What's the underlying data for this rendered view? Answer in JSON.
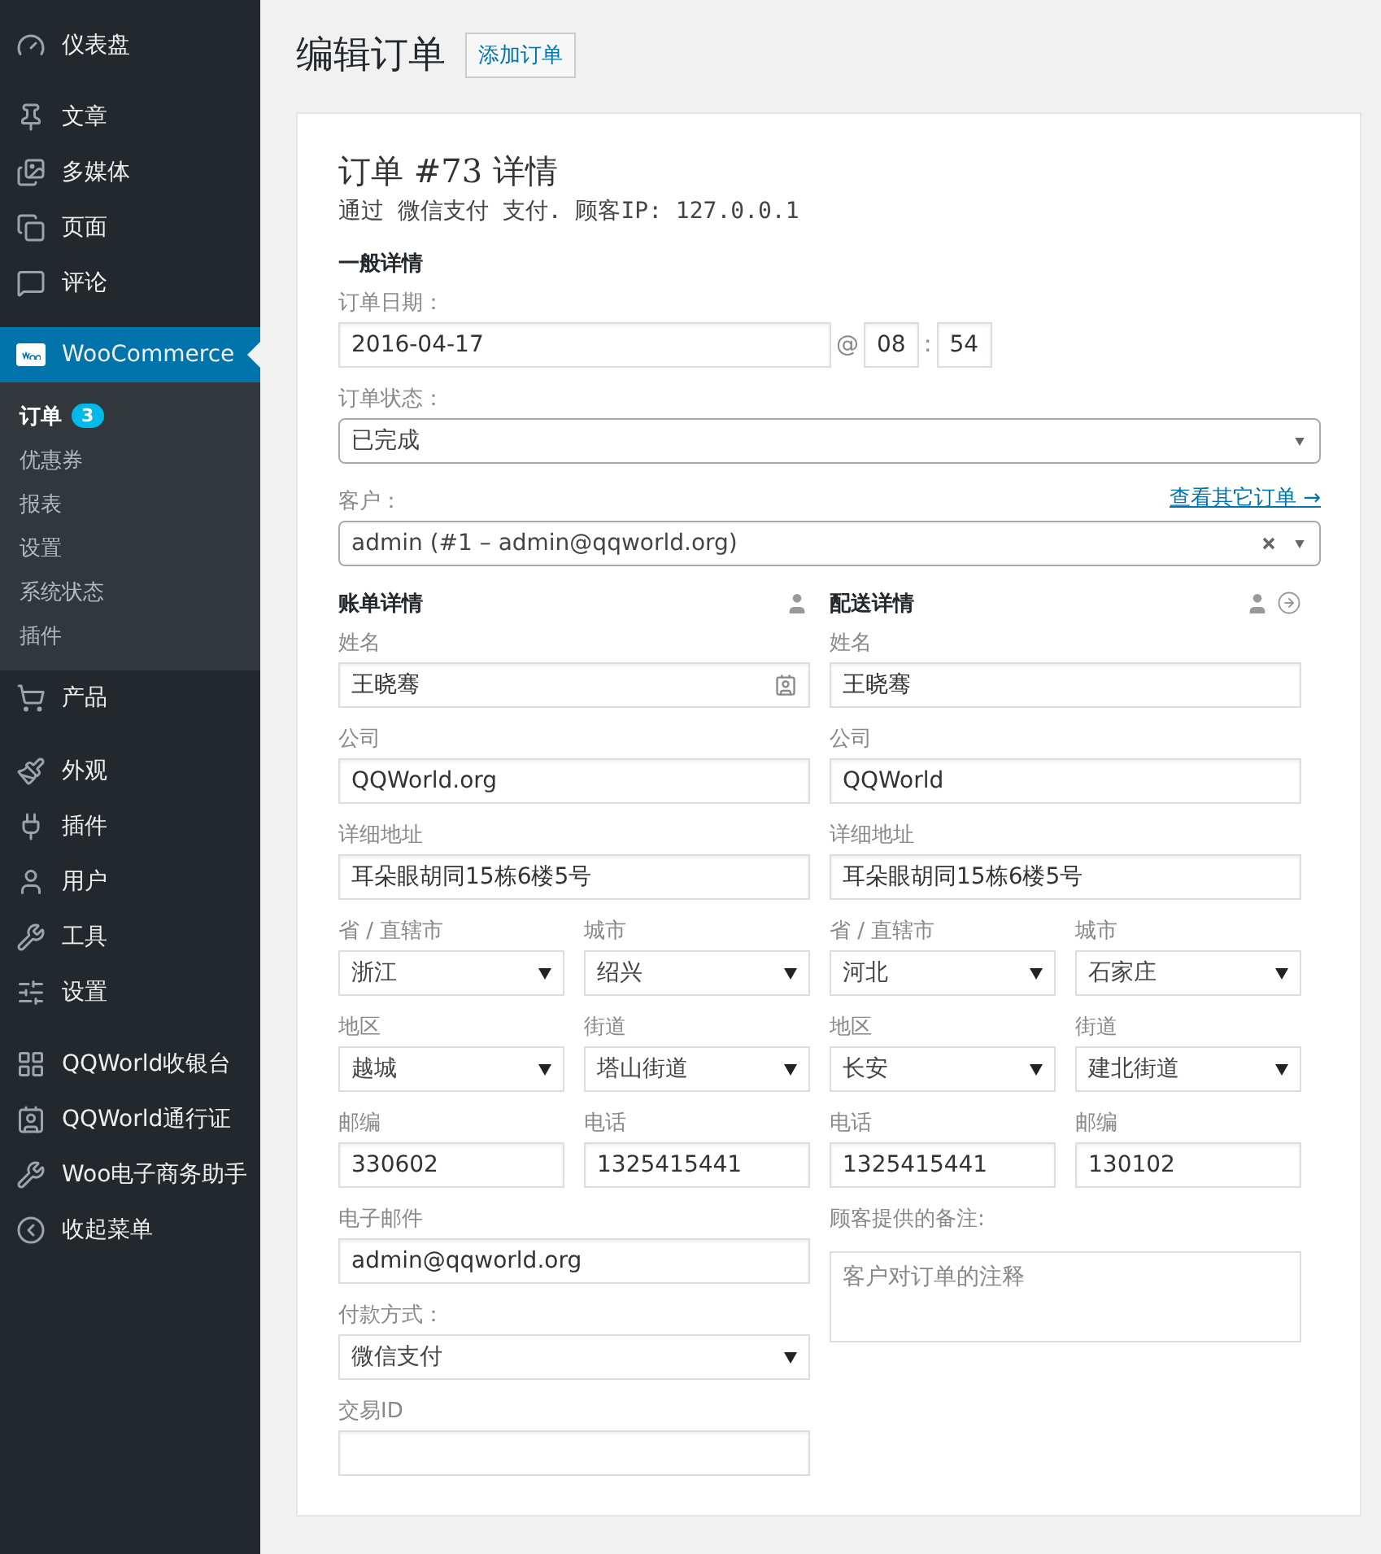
{
  "sidebar": {
    "groups": [
      [
        {
          "label": "仪表盘",
          "selected": false
        }
      ],
      [
        {
          "label": "文章",
          "selected": false
        },
        {
          "label": "多媒体",
          "selected": false
        },
        {
          "label": "页面",
          "selected": false
        },
        {
          "label": "评论",
          "selected": false
        }
      ],
      [
        {
          "label": "WooCommerce",
          "selected": true,
          "children": [
            {
              "label": "订单",
              "selected": true,
              "badge": "3"
            },
            {
              "label": "优惠券",
              "selected": false
            },
            {
              "label": "报表",
              "selected": false
            },
            {
              "label": "设置",
              "selected": false
            },
            {
              "label": "系统状态",
              "selected": false
            },
            {
              "label": "插件",
              "selected": false
            }
          ]
        },
        {
          "label": "产品",
          "selected": false
        }
      ],
      [
        {
          "label": "外观",
          "selected": false
        },
        {
          "label": "插件",
          "selected": false
        },
        {
          "label": "用户",
          "selected": false
        },
        {
          "label": "工具",
          "selected": false
        },
        {
          "label": "设置",
          "selected": false
        }
      ],
      [
        {
          "label": "QQWorld收银台",
          "selected": false
        },
        {
          "label": "QQWorld通行证",
          "selected": false
        },
        {
          "label": "Woo电子商务助手",
          "selected": false
        },
        {
          "label": "收起菜单",
          "selected": false
        }
      ]
    ]
  },
  "page": {
    "title": "编辑订单",
    "add_button": "添加订单"
  },
  "order": {
    "title": "订单 #73 详情",
    "subtitle": "通过 微信支付 支付. 顾客IP: 127.0.0.1",
    "general_heading": "一般详情",
    "date": {
      "label": "订单日期：",
      "value": "2016-04-17",
      "at": "@",
      "hour": "08",
      "separator": ":",
      "minute": "54"
    },
    "status": {
      "label": "订单状态：",
      "value": "已完成"
    },
    "customer": {
      "label": "客户：",
      "link": "查看其它订单 →",
      "value": "admin (#1 – admin@qqworld.org)"
    }
  },
  "billing": {
    "heading": "账单详情",
    "rows": [
      [
        {
          "label": "姓名",
          "value": "王晓骞",
          "kind": "input"
        }
      ],
      [
        {
          "label": "公司",
          "value": "QQWorld.org",
          "kind": "input"
        }
      ],
      [
        {
          "label": "详细地址",
          "value": "耳朵眼胡同15栋6楼5号",
          "kind": "input"
        }
      ],
      [
        {
          "label": "省 / 直辖市",
          "value": "浙江",
          "kind": "select"
        },
        {
          "label": "城市",
          "value": "绍兴",
          "kind": "select"
        }
      ],
      [
        {
          "label": "地区",
          "value": "越城",
          "kind": "select"
        },
        {
          "label": "街道",
          "value": "塔山街道",
          "kind": "select"
        }
      ],
      [
        {
          "label": "邮编",
          "value": "330602",
          "kind": "input"
        },
        {
          "label": "电话",
          "value": "1325415441",
          "kind": "input"
        }
      ],
      [
        {
          "label": "电子邮件",
          "value": "admin@qqworld.org",
          "kind": "input"
        }
      ],
      [
        {
          "label": "付款方式：",
          "value": "微信支付",
          "kind": "select"
        }
      ],
      [
        {
          "label": "交易ID",
          "kind": "input"
        }
      ]
    ]
  },
  "shipping": {
    "heading": "配送详情",
    "rows": [
      [
        {
          "label": "姓名",
          "value": "王晓骞",
          "kind": "input"
        }
      ],
      [
        {
          "label": "公司",
          "value": "QQWorld",
          "kind": "input"
        }
      ],
      [
        {
          "label": "详细地址",
          "value": "耳朵眼胡同15栋6楼5号",
          "kind": "input"
        }
      ],
      [
        {
          "label": "省 / 直辖市",
          "value": "河北",
          "kind": "select"
        },
        {
          "label": "城市",
          "value": "石家庄",
          "kind": "select"
        }
      ],
      [
        {
          "label": "地区",
          "value": "长安",
          "kind": "select"
        },
        {
          "label": "街道",
          "value": "建北街道",
          "kind": "select"
        }
      ],
      [
        {
          "label": "电话",
          "value": "1325415441",
          "kind": "input"
        },
        {
          "label": "邮编",
          "value": "130102",
          "kind": "input"
        }
      ],
      [
        {
          "label": "顾客提供的备注:",
          "placeholder": "客户对订单的注释",
          "kind": "textarea"
        }
      ]
    ]
  }
}
